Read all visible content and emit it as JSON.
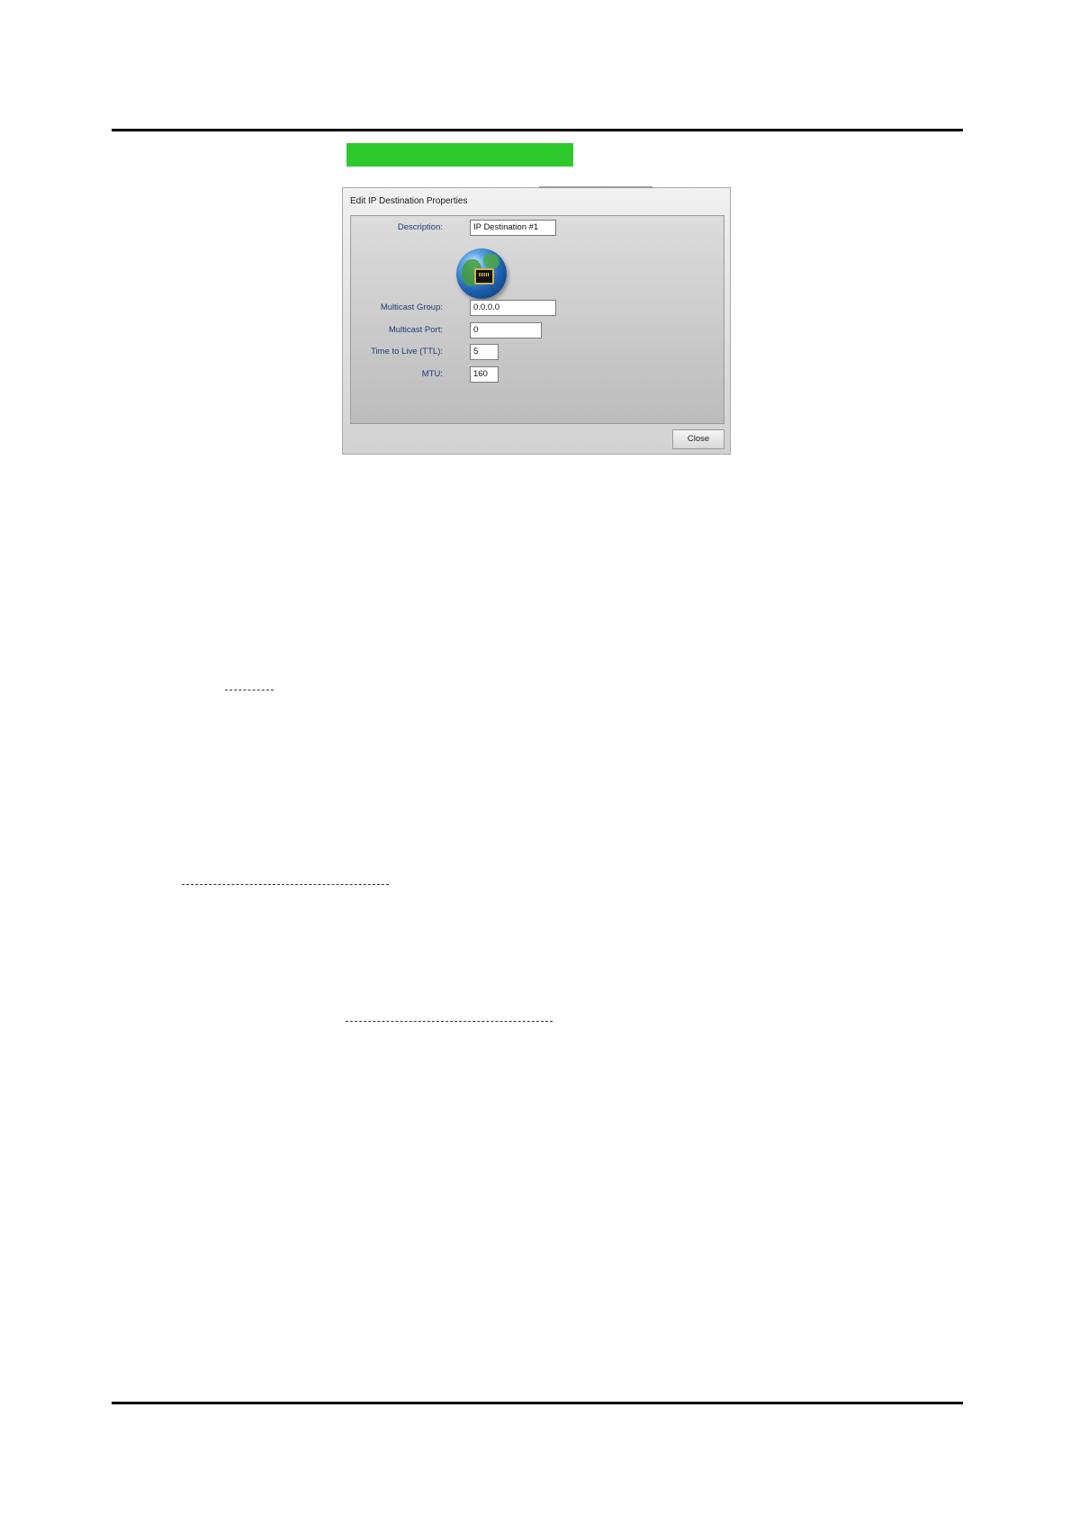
{
  "dialog": {
    "title": "Edit IP Destination Properties",
    "fields": {
      "description": {
        "label": "Description:",
        "value": "IP Destination #1"
      },
      "multicast_group": {
        "label": "Multicast Group:",
        "value": "0.0.0.0"
      },
      "multicast_port": {
        "label": "Multicast Port:",
        "value": "0"
      },
      "ttl": {
        "label": "Time to Live (TTL):",
        "value": "5"
      },
      "mtu": {
        "label": "MTU:",
        "value": "160"
      }
    },
    "close_label": "Close"
  },
  "colors": {
    "highlight": "#2dc92d",
    "label_text": "#1f3a78"
  },
  "icons": {
    "network": "globe-ethernet-icon"
  }
}
